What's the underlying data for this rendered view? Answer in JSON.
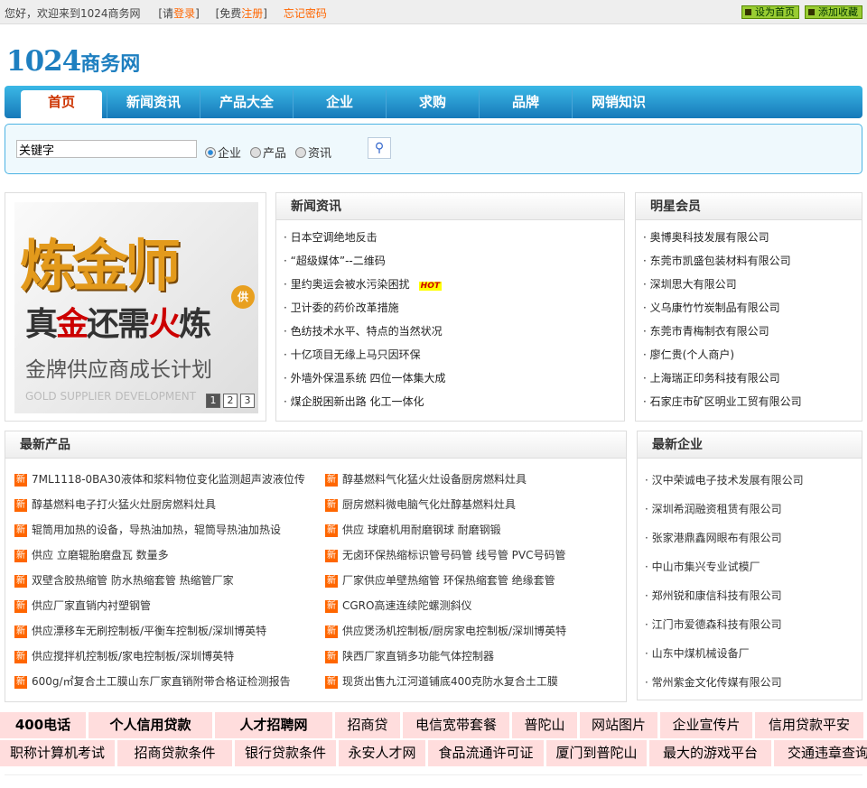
{
  "topbar": {
    "greeting": "您好，欢迎来到1024商务网",
    "login_prefix": "[请",
    "login": "登录",
    "login_suffix": "]",
    "reg_prefix": "[免费",
    "register": "注册",
    "reg_suffix": "]",
    "forgot": "忘记密码",
    "set_home": "设为首页",
    "bookmark": "添加收藏"
  },
  "logo": {
    "num": "1024",
    "text": "商务网"
  },
  "nav": [
    "首页",
    "新闻资讯",
    "产品大全",
    "企业",
    "求购",
    "品牌",
    "网销知识"
  ],
  "search": {
    "value": "关键字",
    "options": [
      "企业",
      "产品",
      "资讯"
    ],
    "selected": "企业"
  },
  "banner": {
    "line1": "炼金师",
    "line2a": "真",
    "line2b": "金",
    "line2c": "还需",
    "line2d": "火",
    "line2e": "炼",
    "line3": "金牌供应商成长计划",
    "line4": "GOLD SUPPLIER DEVELOPMENT",
    "badge": "供",
    "pages": [
      "1",
      "2",
      "3"
    ]
  },
  "news": {
    "title": "新闻资讯",
    "hot": "HOT",
    "items": [
      "日本空调绝地反击",
      "“超级媒体”--二维码",
      "里约奥运会被水污染困扰",
      "卫计委的药价改革措施",
      "色纺技术水平、特点的当然状况",
      "十亿项目无缘上马只因环保",
      "外墙外保温系统 四位一体集大成",
      "煤企脱困新出路 化工一体化"
    ]
  },
  "members": {
    "title": "明星会员",
    "items": [
      "奥博奥科技发展有限公司",
      "东莞市凯盛包装材料有限公司",
      "深圳思大有限公司",
      "义乌康竹竹炭制品有限公司",
      "东莞市青梅制衣有限公司",
      "廖仁贵(个人商户)",
      "上海瑞正印务科技有限公司",
      "石家庄市矿区明业工贸有限公司"
    ]
  },
  "products": {
    "title": "最新产品",
    "badge": "新",
    "left": [
      "7ML1118-0BA30液体和浆料物位变化监测超声波液位传",
      "醇基燃料电子打火猛火灶厨房燃料灶具",
      "辊筒用加热的设备，导热油加热，辊筒导热油加热设",
      "供应 立磨辊胎磨盘瓦 数量多",
      "双壁含胶热缩管 防水热缩套管 热缩管厂家",
      "供应厂家直销内衬塑钢管",
      "供应漂移车无刷控制板/平衡车控制板/深圳博英特",
      "供应搅拌机控制板/家电控制板/深圳博英特",
      "600g/㎡复合土工膜山东厂家直销附带合格证检测报告"
    ],
    "right": [
      "醇基燃料气化猛火灶设备厨房燃料灶具",
      "厨房燃料微电脑气化灶醇基燃料灶具",
      "供应 球磨机用耐磨钢球 耐磨钢锻",
      "无卤环保热缩标识管号码管 线号管 PVC号码管",
      "厂家供应单壁热缩管 环保热缩套管 绝缘套管",
      "CGRO高速连续陀螺测斜仪",
      "供应煲汤机控制板/厨房家电控制板/深圳博英特",
      "陕西厂家直销多功能气体控制器",
      "现货出售九江河道铺底400克防水复合土工膜"
    ]
  },
  "companies": {
    "title": "最新企业",
    "items": [
      "汉中荣诚电子技术发展有限公司",
      "深圳希润融资租赁有限公司",
      "张家港鼎鑫网眼布有限公司",
      "中山市集兴专业试模厂",
      "郑州锐和康信科技有限公司",
      "江门市爱德森科技有限公司",
      "山东中煤机械设备厂",
      "常州紫金文化传媒有限公司"
    ]
  },
  "links_row1": [
    "400电话",
    "个人信用贷款",
    "人才招聘网",
    "招商贷",
    "电信宽带套餐",
    "普陀山",
    "网站图片",
    "企业宣传片",
    "信用贷款平安"
  ],
  "links_row2": [
    "职称计算机考试",
    "招商贷款条件",
    "银行贷款条件",
    "永安人才网",
    "食品流通许可证",
    "厦门到普陀山",
    "最大的游戏平台",
    "交通违章查询"
  ]
}
